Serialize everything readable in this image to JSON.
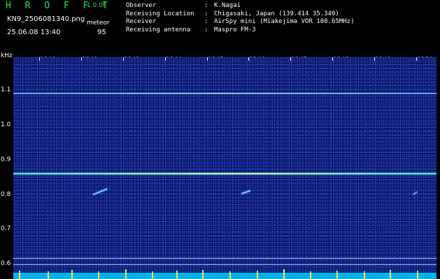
{
  "header": {
    "app_title": "H R O F F T",
    "version": "1.0.0f",
    "filename": "KN9_2506081340.png",
    "meteor_label": "meteor",
    "datetime": "25.06.08 13:40",
    "meteor_count": "95",
    "info": [
      {
        "label": "Observer",
        "value": "K.Nagai"
      },
      {
        "label": "Receiving Location",
        "value": "Chigasaki, Japan (139.414 35.340)"
      },
      {
        "label": "Receiver",
        "value": "AirSpy mini (Miakejima VOR 108.65MHz)"
      },
      {
        "label": "Receiving antenna",
        "value": "Maspro FM-3"
      }
    ]
  },
  "plot": {
    "unit_label": "kHz",
    "x_ticks": [
      "1341",
      "1342",
      "1343",
      "1344",
      "1345",
      "1346",
      "1347",
      "1348",
      "1349",
      "1350"
    ],
    "y_ticks": [
      "1.1",
      "1.0",
      "0.9",
      "0.8",
      "0.7",
      "0.6"
    ],
    "colors": {
      "background": "#0a1670",
      "signal_line": "#9ff7b0",
      "reference_line": "#6fc6ff",
      "baseline": "#00b4e8",
      "spikes": "#e0e85a"
    }
  }
}
